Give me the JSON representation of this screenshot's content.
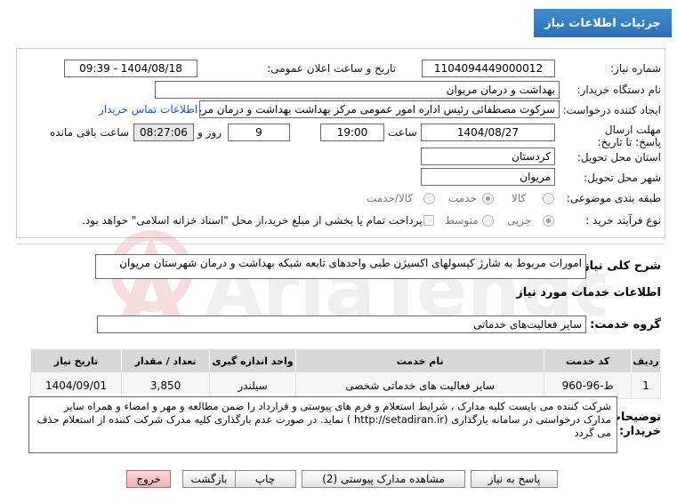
{
  "header": {
    "title": "جزئیات اطلاعات نیاز"
  },
  "form": {
    "need_number_label": "شماره نیاز:",
    "need_number": "1104094449000012",
    "announce_label": "تاریخ و ساعت اعلان عمومی:",
    "announce_value": "1404/08/18 - 09:39",
    "buyer_org_label": "نام دستگاه خریدار:",
    "buyer_org": "بهداشت و درمان مریوان",
    "creator_label": "ایجاد کننده درخواست:",
    "creator": "سرکوت مصطفائی رئیس اداره امور عمومی مرکز بهداشت بهداشت و درمان مریوا",
    "contact_link": "اطلاعات تماس خریدار",
    "deadline_label": "مهلت ارسال پاسخ: تا تاریخ:",
    "deadline_date": "1404/08/27",
    "time_label": "ساعت",
    "deadline_time": "19:00",
    "days_value": "9",
    "days_and_label": "روز و",
    "remaining_time": "08:27:06",
    "remaining_label": "ساعت باقی مانده",
    "province_label": "استان محل تحویل:",
    "province": "کردستان",
    "city_label": "شهر محل تحویل:",
    "city": "مریوان",
    "category_label": "طبقه بندی موضوعی:",
    "category_options": [
      "کالا",
      "خدمت",
      "کالا/خدمت"
    ],
    "category_selected": "خدمت",
    "process_label": "نوع فرآیند خرید :",
    "process_options": [
      "جزیی",
      "متوسط"
    ],
    "process_selected": "جزیی",
    "payment_note": "پرداخت تمام یا بخشی از مبلغ خرید،از محل \"اسناد خزانه اسلامی\" خواهد بود."
  },
  "description": {
    "label": "شرح کلی نیاز:",
    "text": "امورات مربوط به شارژ کپسولهای اکسیژن طبی واحدهای تابعه شبکه بهداشت و درمان شهرستان مریوان"
  },
  "services": {
    "section_title": "اطلاعات خدمات مورد نیاز",
    "group_label": "گروه خدمت:",
    "group_value": "سایر فعالیت‌های خدماتی",
    "columns": [
      "ردیف",
      "کد خدمت",
      "نام خدمت",
      "واحد اندازه گیری",
      "تعداد / مقدار",
      "تاریخ نیاز"
    ],
    "rows": [
      [
        "1",
        "ط-96-960",
        "سایر فعالیت های خدماتی شخصی",
        "سیلندر",
        "3,850",
        "1404/09/01"
      ]
    ]
  },
  "buyer_notes": {
    "label": "توضیحات خریدار:",
    "text": "شرکت کننده می بایست  کلیه مدارک ، شرایط استعلام و فرم های پیوستی و قرارداد را ضمن مطالعه و مهر و امضاء و همراه سایر مدارک درخواستی در سامانه بارگذاری  (http://setadiran.ir )  نماید. در صورت عدم بارگذاری کلیه مدرک شرکت کننده از استعلام حذف می گردد"
  },
  "buttons": {
    "reply": "پاسخ به نیاز",
    "attachments": "مشاهده مدارک پیوستی (2)",
    "print": "چاپ",
    "back": "بازگشت",
    "exit": "خروج"
  },
  "watermark": {
    "text": "AriaTender.neT"
  }
}
